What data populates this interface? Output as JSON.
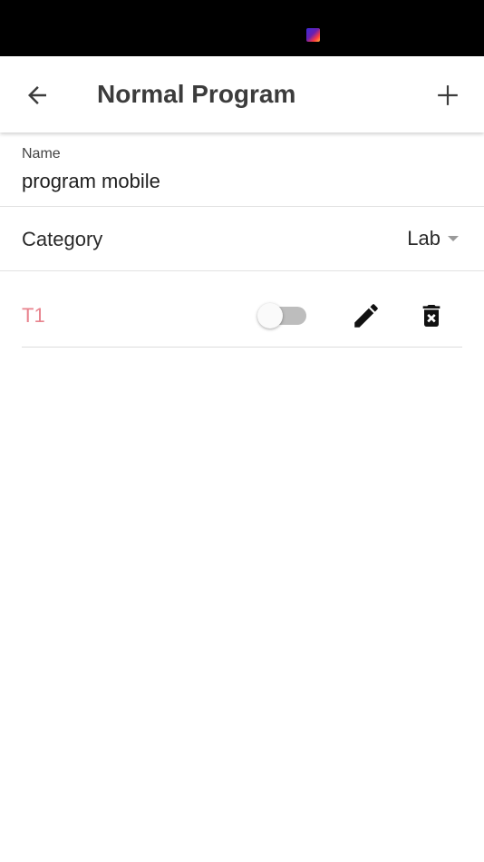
{
  "header": {
    "title": "Normal Program",
    "back_icon": "arrow-left-icon",
    "add_icon": "plus-icon"
  },
  "form": {
    "name_label": "Name",
    "name_value": "program mobile",
    "category_label": "Category",
    "category_value": "Lab"
  },
  "programs": [
    {
      "name": "T1",
      "enabled": false,
      "edit_icon": "pencil-icon",
      "delete_icon": "trash-icon"
    }
  ],
  "colors": {
    "program_name": "#e8838e",
    "title_text": "#3c3c3c",
    "toggle_off_track": "#bdbdbd",
    "status_bar": "#000000"
  }
}
